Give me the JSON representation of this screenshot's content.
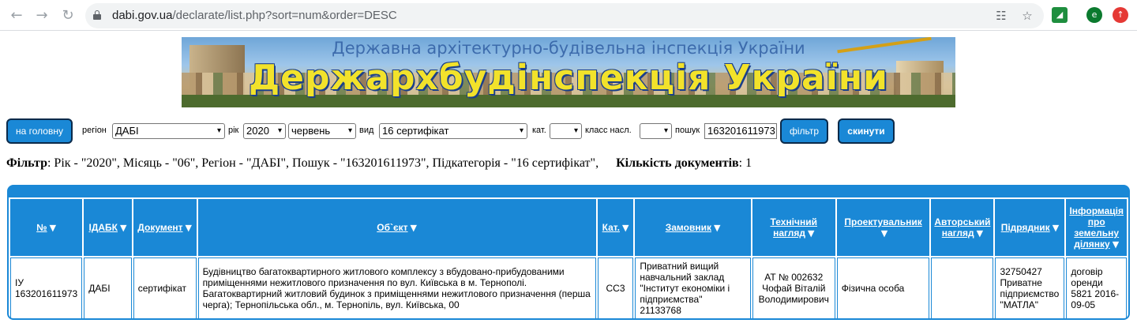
{
  "browser": {
    "url_host": "dabi.gov.ua",
    "url_rest": "/declarate/list.php?sort=num&order=DESC",
    "profile_letter": "e"
  },
  "banner": {
    "subtitle": "Державна архітектурно-будівельна інспекція України",
    "title": "Держархбудінспекція України"
  },
  "filters": {
    "home_button": "на головну",
    "region_label": "регіон",
    "region_value": "ДАБІ",
    "year_label": "рік",
    "year_value": "2020",
    "month_value": "червень",
    "type_label": "вид",
    "type_value": "16 сертифікат",
    "category_label": "кат.",
    "category_value": "",
    "class_label": "класс насл.",
    "class_value": "",
    "search_label": "пошук",
    "search_value": "163201611973",
    "filter_button": "фільтр",
    "reset_button": "скинути"
  },
  "summary": {
    "filter_label": "Фільтр",
    "filter_text": ": Рік - \"2020\", Місяць - \"06\", Регіон - \"ДАБІ\", Пошук - \"163201611973\", Підкатегорія - \"16 сертифікат\",",
    "count_label": "Кількість документів",
    "count_text": ": 1"
  },
  "table": {
    "columns": [
      "№",
      "ІДАБК",
      "Документ",
      "Об`єкт",
      "Кат.",
      "Замовник",
      "Технічний нагляд",
      "Проектувальник",
      "Авторський нагляд",
      "Підрядник",
      "Інформація про земельну ділянку"
    ],
    "rows": [
      {
        "num": "ІУ 163201611973",
        "idabk": "ДАБІ",
        "doc": "сертифікат",
        "object": "Будівництво багатоквартирного житлового комплексу з вбудовано-прибудованими приміщеннями нежитлового призначення по вул. Київська в м. Тернополі. Багатоквартирний житловий будинок з приміщеннями нежитлового призначення (перша черга); Тернопільська обл., м. Тернопіль, вул. Київська, 00",
        "cat": "СС3",
        "customer": "Приватний вищий навчальний заклад \"Інститут економіки і підприємства\" 21133768",
        "tech": "АТ № 002632 Чофай Віталій Володимирович",
        "designer": "Фізична особа",
        "author": "",
        "contractor": "32750427 Приватне підприємство \"МАТЛА\"",
        "land": "договір оренди 5821 2016-09-05"
      }
    ]
  }
}
